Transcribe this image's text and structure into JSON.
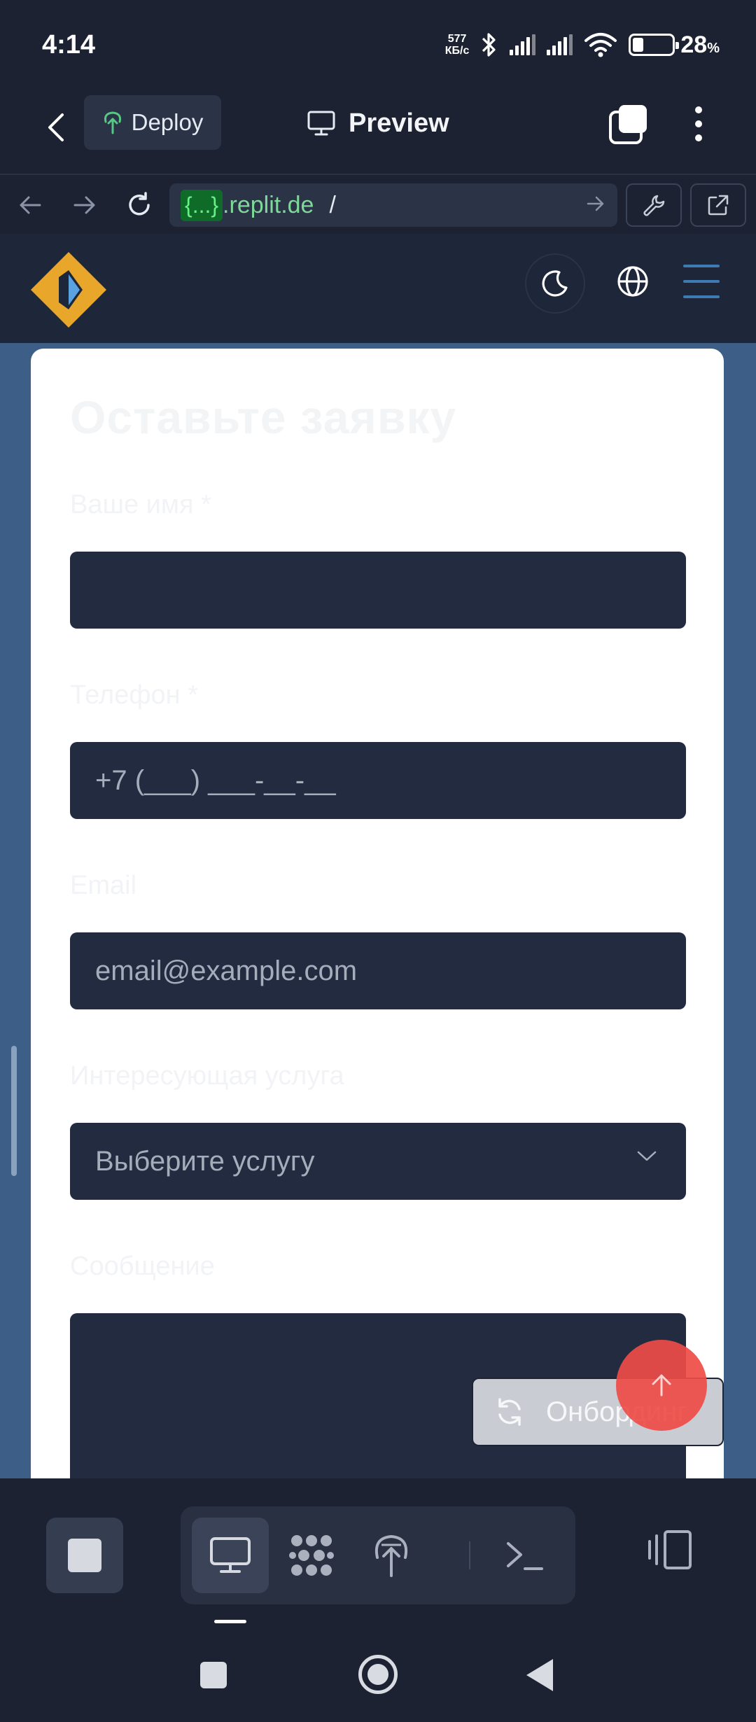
{
  "status_bar": {
    "time": "4:14",
    "net_speed_value": "577",
    "net_speed_unit": "КБ/с",
    "battery_percent": "28",
    "battery_symbol": "%",
    "battery_level": 0.28
  },
  "header": {
    "deploy_label": "Deploy",
    "preview_label": "Preview"
  },
  "url_bar": {
    "badge": "{...}",
    "domain": ".replit.de",
    "path": "/"
  },
  "form": {
    "title": "Оставьте заявку",
    "name_label": "Ваше имя *",
    "name_value": "",
    "phone_label": "Телефон *",
    "phone_placeholder": "+7 (___) ___-__-__",
    "email_label": "Email",
    "email_placeholder": "email@example.com",
    "service_label": "Интересующая услуга",
    "service_selected": "Выберите услугу",
    "message_label": "Сообщение",
    "message_value": ""
  },
  "floating": {
    "onboarding_label": "Онбординг"
  },
  "colors": {
    "accent_logo": "#e8a72a",
    "scroll_top": "#ee4c46",
    "field_bg": "#222b40",
    "url_domain": "#7fd89a"
  },
  "icons": [
    "back-icon",
    "deploy-icon",
    "monitor-icon",
    "tabs-icon",
    "more-icon",
    "arrow-left-icon",
    "arrow-right-icon",
    "reload-icon",
    "go-icon",
    "wrench-icon",
    "external-link-icon",
    "moon-icon",
    "globe-icon",
    "hamburger-icon",
    "chevron-down-icon",
    "refresh-icon",
    "arrow-up-icon",
    "stop-icon",
    "desktop-icon",
    "grid-icon",
    "deploy-tool-icon",
    "terminal-icon",
    "layout-icon"
  ]
}
